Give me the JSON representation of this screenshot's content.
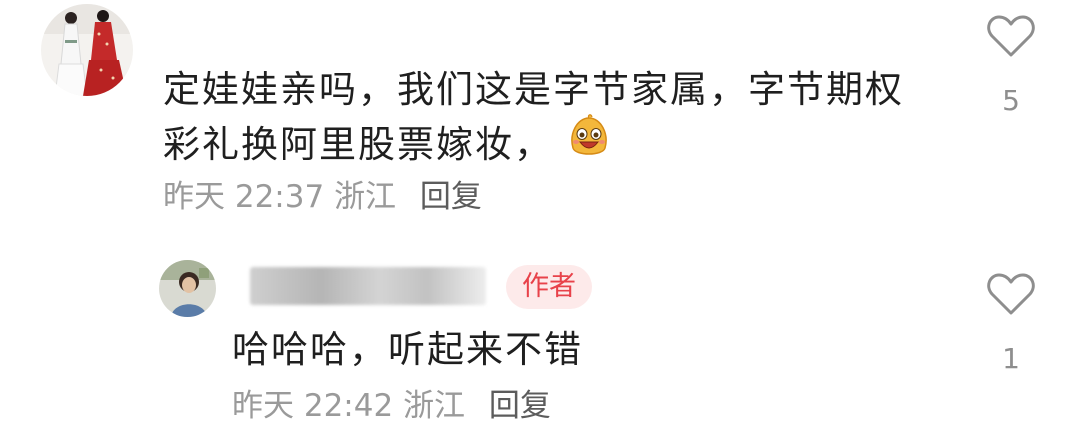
{
  "comment": {
    "text": "定娃娃亲吗，我们这是字节家属，字节期权彩礼换阿里股票嫁妆，",
    "time": "昨天 22:37",
    "location": "浙江",
    "reply_label": "回复",
    "like_count": "5",
    "emoji_icon": "grinning-face-emoji"
  },
  "reply": {
    "author_badge": "作者",
    "text": "哈哈哈，听起来不错",
    "time": "昨天 22:42",
    "location": "浙江",
    "reply_label": "回复",
    "like_count": "1"
  },
  "colors": {
    "text_primary": "#1f1f1f",
    "text_meta": "#9a9a9a",
    "badge_text": "#e8424a",
    "badge_bg": "#fdeaea",
    "icon_gray": "#8e8e8e"
  }
}
